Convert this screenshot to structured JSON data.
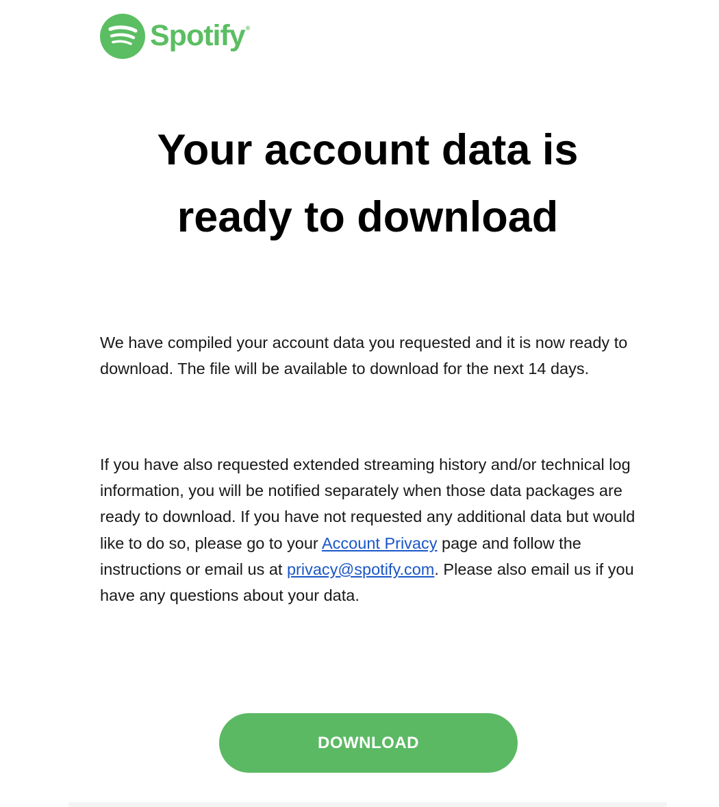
{
  "brand": {
    "name": "Spotify",
    "registered_mark": "®",
    "color": "#5bbe62",
    "logo_icon": "spotify-logo-icon"
  },
  "headline": "Your account data is ready to download",
  "paragraph1": "We have compiled your account data you requested and it is now ready to download. The file will be available to download for the next 14 days.",
  "paragraph2": {
    "text_a": "If you have also requested extended streaming history and/or technical log information, you will be notified separately when those data packages are ready to download. If you have not requested any additional data but would like to do so, please go to your ",
    "link_account_privacy": "Account Privacy",
    "text_b": " page and follow the instructions or email us at ",
    "link_email": "privacy@spotify.com",
    "text_c": ". Please also email us if you have any questions about your data."
  },
  "download_button": {
    "label": "DOWNLOAD",
    "color": "#5bb963"
  },
  "colors": {
    "link": "#1a57c7",
    "text": "#181818",
    "headline": "#000000"
  }
}
